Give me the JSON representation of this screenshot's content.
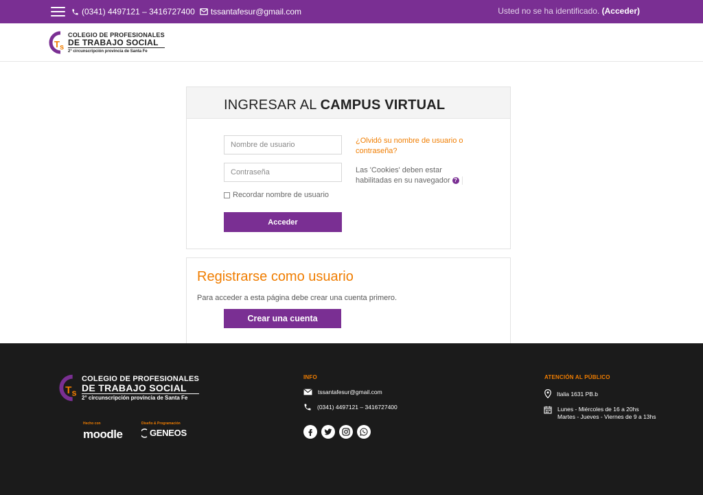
{
  "topbar": {
    "phone": "(0341) 4497121 – 3416727400",
    "email": "tssantafesur@gmail.com",
    "not_identified": "Usted no se ha identificado.",
    "login_link": "(Acceder)"
  },
  "logo": {
    "line1": "COLEGIO DE PROFESIONALES",
    "line2": "DE TRABAJO SOCIAL",
    "line3": "2° circunscripción provincia de Santa Fe"
  },
  "login": {
    "title_light": "INGRESAR AL",
    "title_bold": "CAMPUS VIRTUAL",
    "username_placeholder": "Nombre de usuario",
    "password_placeholder": "Contraseña",
    "remember_label": "Recordar nombre de usuario",
    "submit_label": "Acceder",
    "forgot_link": "¿Olvidó su nombre de usuario o contraseña?",
    "cookies_note": "Las 'Cookies' deben estar habilitadas en su navegador"
  },
  "register": {
    "title": "Registrarse como usuario",
    "description": "Para acceder a esta página debe crear una cuenta primero.",
    "button_label": "Crear una cuenta"
  },
  "footer": {
    "made_with_label": "Hecho con",
    "made_with_brand": "moodle",
    "design_label": "Diseño & Programación",
    "design_brand": "GENEOS",
    "info_heading": "INFO",
    "info_email": "tssantafesur@gmail.com",
    "info_phone": "(0341) 4497121 – 3416727400",
    "attention_heading": "ATENCIÓN AL PÚBLICO",
    "address": "Italia 1631 PB.b",
    "hours_line1": "Lunes -  Miércoles de 16 a 20hs",
    "hours_line2": "Martes - Jueves - Viernes de 9 a 13hs"
  },
  "colors": {
    "primary": "#7a2f93",
    "accent": "#f07d00",
    "footer_bg": "#1b1b1b"
  },
  "icons": {
    "menu": "hamburger-icon",
    "phone": "phone-icon",
    "email": "envelope-icon",
    "help": "question-circle-icon",
    "location": "map-pin-icon",
    "calendar": "calendar-icon",
    "social": [
      "facebook-icon",
      "twitter-icon",
      "instagram-icon",
      "whatsapp-icon"
    ]
  }
}
